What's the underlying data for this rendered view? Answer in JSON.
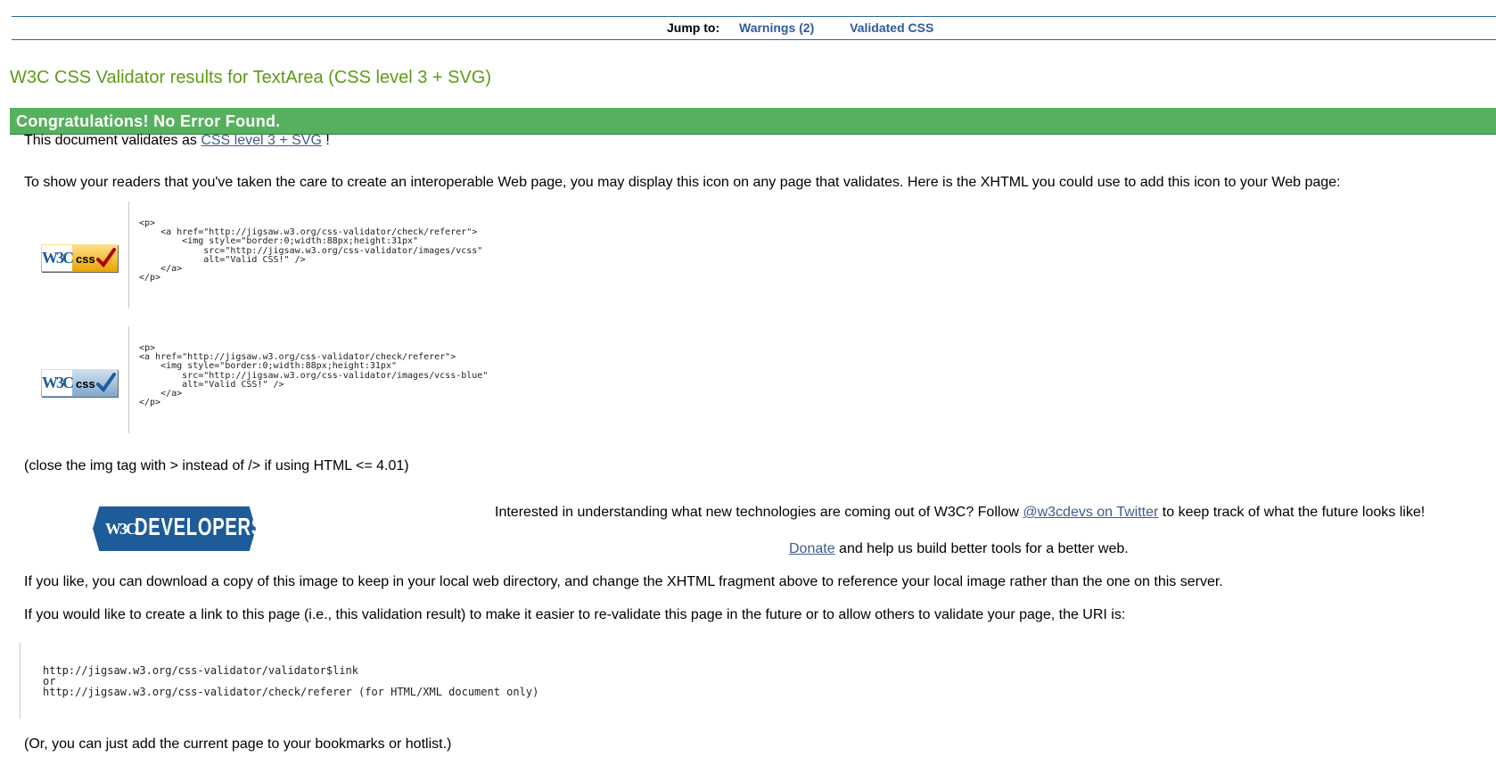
{
  "jump": {
    "label": "Jump to:",
    "links": [
      "Warnings (2)",
      "Validated CSS"
    ]
  },
  "title": "W3C CSS Validator results for TextArea (CSS level 3 + SVG)",
  "congrats": "Congratulations! No Error Found.",
  "validates": {
    "prefix": "This document validates as ",
    "link": "CSS level 3 + SVG",
    "suffix": " !"
  },
  "show_readers": "To show your readers that you've taken the care to create an interoperable Web page, you may display this icon on any page that validates. Here is the XHTML you could use to add this icon to your Web page:",
  "badges": [
    {
      "w3c": "W3C",
      "css": "css",
      "code": "<p>\n    <a href=\"http://jigsaw.w3.org/css-validator/check/referer\">\n        <img style=\"border:0;width:88px;height:31px\"\n            src=\"http://jigsaw.w3.org/css-validator/images/vcss\"\n            alt=\"Valid CSS!\" />\n    </a>\n</p>"
    },
    {
      "w3c": "W3C",
      "css": "css",
      "code": "<p>\n<a href=\"http://jigsaw.w3.org/css-validator/check/referer\">\n    <img style=\"border:0;width:88px;height:31px\"\n        src=\"http://jigsaw.w3.org/css-validator/images/vcss-blue\"\n        alt=\"Valid CSS!\" />\n    </a>\n</p>"
    }
  ],
  "close_img_note": "(close the img tag with > instead of /> if using HTML <= 4.01)",
  "developers": {
    "logo_w3c": "W3C",
    "logo_text": "DEVELOPERS",
    "interested_prefix": "Interested in understanding what new technologies are coming out of W3C? Follow ",
    "twitter_link": "@w3cdevs on Twitter",
    "interested_suffix": " to keep track of what the future looks like!",
    "donate_link": "Donate",
    "donate_suffix": " and help us build better tools for a better web."
  },
  "download_note": "If you like, you can download a copy of this image to keep in your local web directory, and change the XHTML fragment above to reference your local image rather than the one on this server.",
  "link_note": "If you would like to create a link to this page (i.e., this validation result) to make it easier to re-validate this page in the future or to allow others to validate your page, the URI is:",
  "uri_block": "http://jigsaw.w3.org/css-validator/validator$link\nor\nhttp://jigsaw.w3.org/css-validator/check/referer (for HTML/XML document only)",
  "bookmark_note": "(Or, you can just add the current page to your bookmarks or hotlist.)"
}
